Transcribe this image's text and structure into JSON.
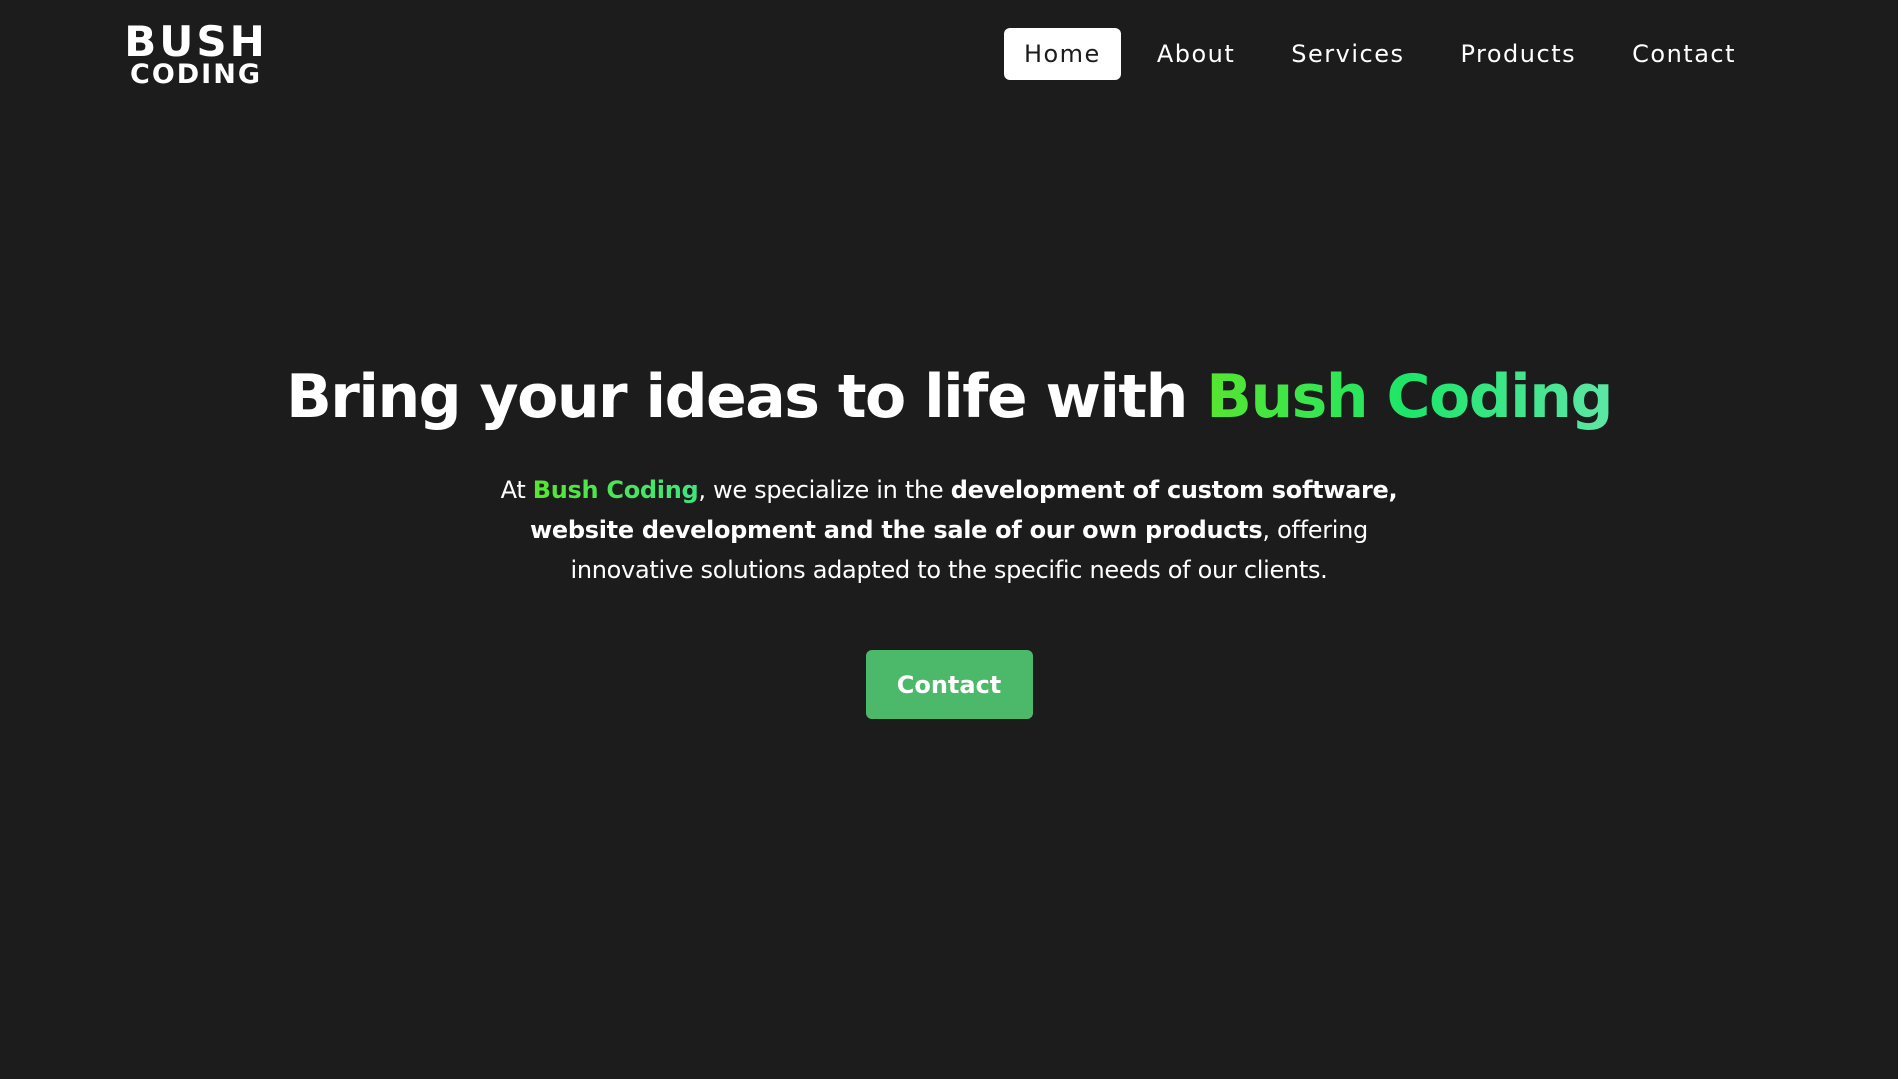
{
  "header": {
    "logo": {
      "line1": "BUSH",
      "line2": "CODING"
    },
    "nav": [
      {
        "label": "Home",
        "active": true
      },
      {
        "label": "About",
        "active": false
      },
      {
        "label": "Services",
        "active": false
      },
      {
        "label": "Products",
        "active": false
      },
      {
        "label": "Contact",
        "active": false
      }
    ]
  },
  "hero": {
    "title_prefix": "Bring your ideas to life with ",
    "title_brand": "Bush Coding",
    "desc_at": "At ",
    "desc_brand": "Bush Coding",
    "desc_mid": ", we specialize in the ",
    "desc_bold": "development of custom software, website development and the sale of our own products",
    "desc_end": ", offering innovative solutions adapted to the specific needs of our clients.",
    "cta_label": "Contact"
  },
  "colors": {
    "background": "#1c1c1c",
    "brand_green_start": "#56e52f",
    "brand_green_end": "#5ee6a6",
    "cta_green": "#4cb96a"
  }
}
